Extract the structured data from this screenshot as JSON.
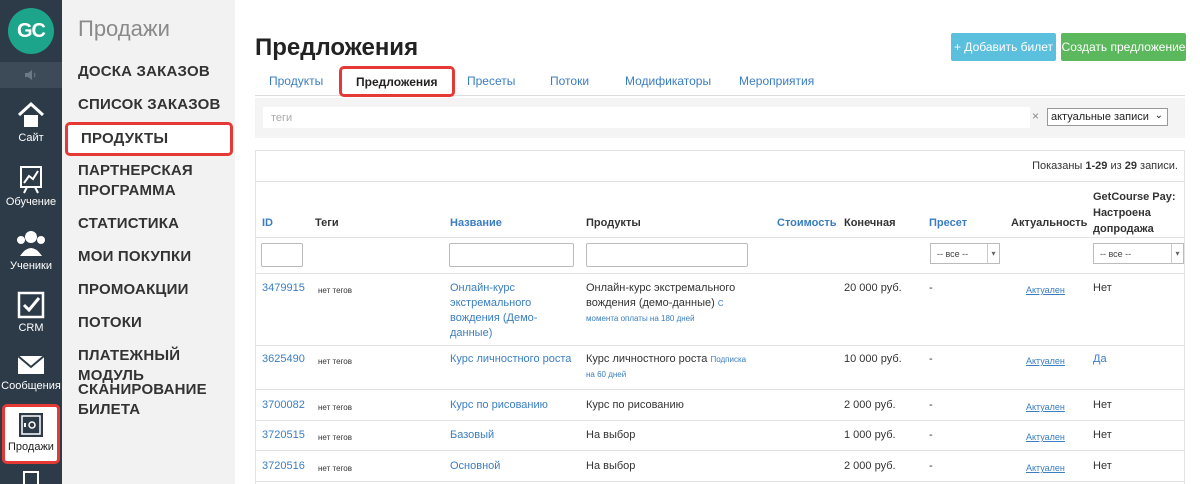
{
  "rail": {
    "logo": "GC",
    "items": [
      {
        "label": "Сайт",
        "icon": "home-icon"
      },
      {
        "label": "Обучение",
        "icon": "chart-board-icon"
      },
      {
        "label": "Ученики",
        "icon": "users-icon"
      },
      {
        "label": "CRM",
        "icon": "checkbox-icon"
      },
      {
        "label": "Сообщения",
        "icon": "envelope-icon"
      },
      {
        "label": "Продажи",
        "icon": "safe-icon"
      }
    ]
  },
  "submenu": {
    "title": "Продажи",
    "items": [
      "ДОСКА ЗАКАЗОВ",
      "СПИСОК ЗАКАЗОВ",
      "ПРОДУКТЫ",
      "ПАРТНЕРСКАЯ ПРОГРАММА",
      "СТАТИСТИКА",
      "МОИ ПОКУПКИ",
      "ПРОМОАКЦИИ",
      "ПОТОКИ",
      "ПЛАТЕЖНЫЙ МОДУЛЬ",
      "СКАНИРОВАНИЕ БИЛЕТА"
    ]
  },
  "page": {
    "title": "Предложения",
    "add_ticket": "+ Добавить билет",
    "create_offer": "Создать предложение"
  },
  "tabs": [
    "Продукты",
    "Предложения",
    "Пресеты",
    "Потоки",
    "Модификаторы",
    "Мероприятия"
  ],
  "filter": {
    "tags_placeholder": "теги",
    "clear": "×",
    "actual_select": "актуальные записи"
  },
  "table": {
    "shown_prefix": "Показаны ",
    "shown_range": "1-29",
    "shown_mid": " из ",
    "shown_total": "29",
    "shown_suffix": " записи.",
    "headers": {
      "id": "ID",
      "tags": "Теги",
      "name": "Название",
      "products": "Продукты",
      "price": "Стоимость",
      "final": "Конечная",
      "preset": "Пресет",
      "actual": "Актуальность",
      "gcpay": "GetCourse Pay: Настроена допродажа"
    },
    "filter_all": "-- все --",
    "rows": [
      {
        "id": "3479915",
        "tags": "нет тегов",
        "name": "Онлайн-курс экстремального вождения (Демо-данные)",
        "product": "Онлайн-курс экстремального вождения (демо-данные)",
        "product_sub": "С момента оплаты на 180 дней",
        "final": "20 000 руб.",
        "preset": "-",
        "actual": "Актуален",
        "gcpay": "Нет"
      },
      {
        "id": "3625490",
        "tags": "нет тегов",
        "name": "Курс личностного роста",
        "product": "Курс личностного роста",
        "product_sub": "Подписка на 60 дней",
        "final": "10 000 руб.",
        "preset": "-",
        "actual": "Актуален",
        "gcpay": "Да"
      },
      {
        "id": "3700082",
        "tags": "нет тегов",
        "name": "Курс по рисованию",
        "product": "Курс по рисованию",
        "product_sub": "",
        "final": "2 000 руб.",
        "preset": "-",
        "actual": "Актуален",
        "gcpay": "Нет"
      },
      {
        "id": "3720515",
        "tags": "нет тегов",
        "name": "Базовый",
        "product": "На выбор",
        "product_sub": "",
        "final": "1 000 руб.",
        "preset": "-",
        "actual": "Актуален",
        "gcpay": "Нет"
      },
      {
        "id": "3720516",
        "tags": "нет тегов",
        "name": "Основной",
        "product": "На выбор",
        "product_sub": "",
        "final": "2 000 руб.",
        "preset": "-",
        "actual": "Актуален",
        "gcpay": "Нет"
      }
    ]
  },
  "colors": {
    "accent": "#3a7ec1",
    "highlight": "#e53935",
    "rail": "#2d3b48",
    "create": "#5cb85c",
    "ticket": "#5bc0de"
  }
}
